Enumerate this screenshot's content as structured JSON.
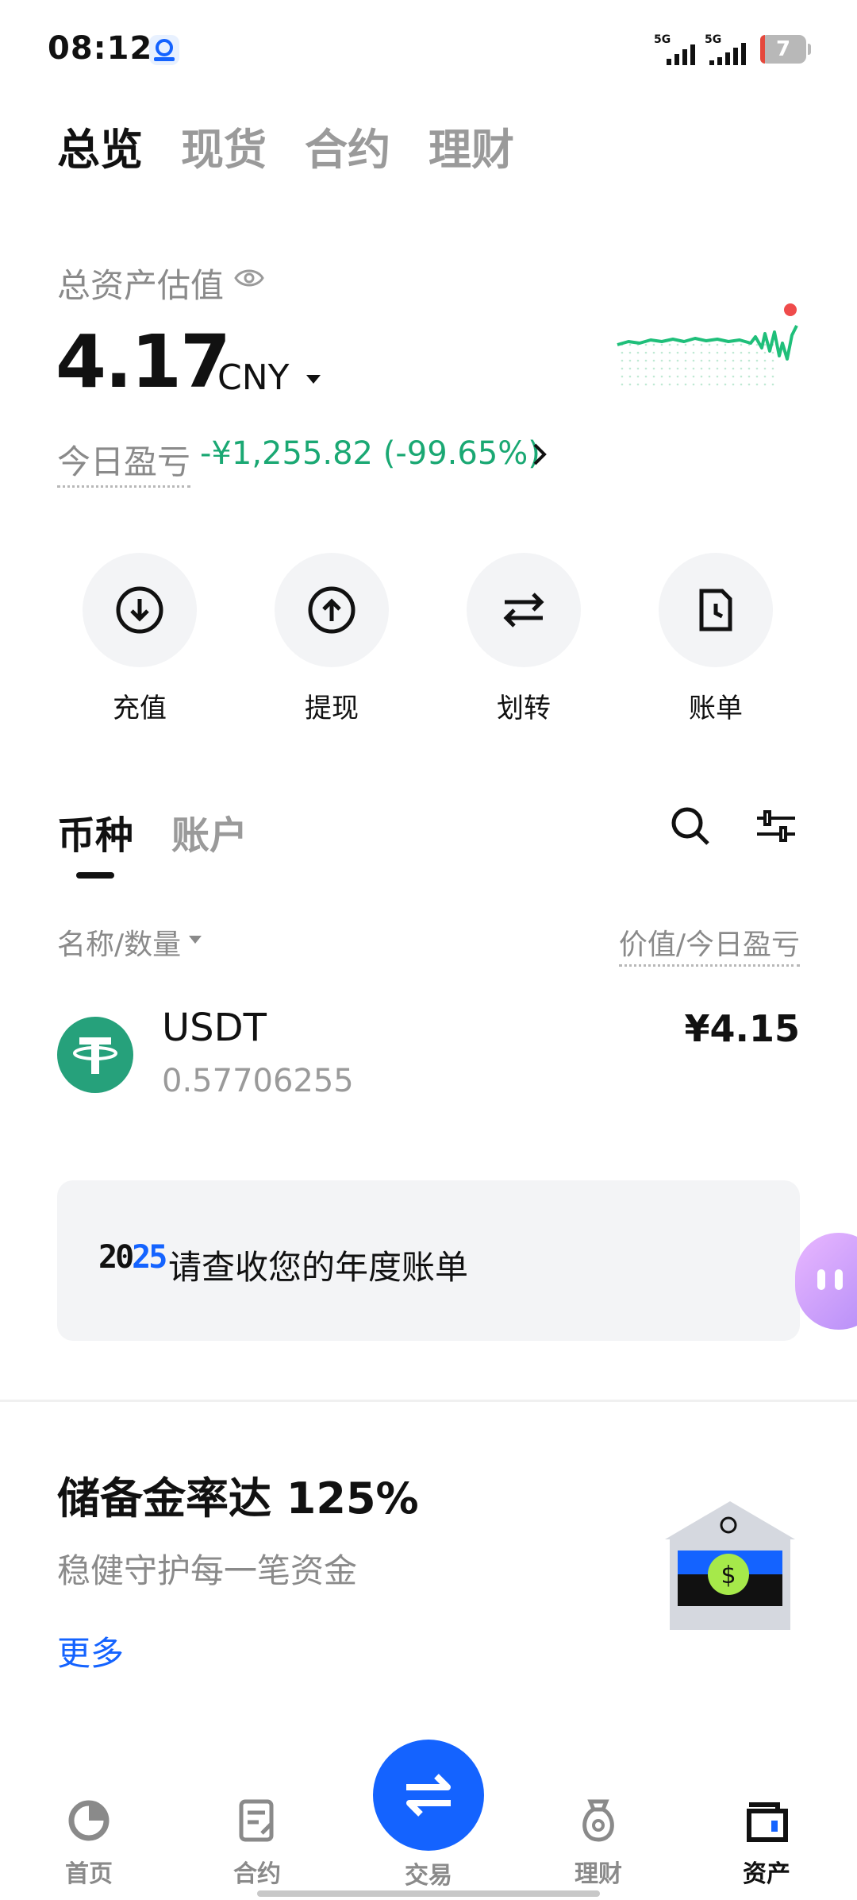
{
  "status_bar": {
    "time": "08:12",
    "signal1": "5G",
    "signal2": "5G",
    "battery": "7"
  },
  "top_tabs": [
    "总览",
    "现货",
    "合约",
    "理财"
  ],
  "summary": {
    "label": "总资产估值",
    "amount": "4.17",
    "currency": "CNY",
    "pnl_label": "今日盈亏",
    "pnl_value": "-¥1,255.82 (-99.65%)"
  },
  "actions": [
    {
      "label": "充值",
      "icon": "download-icon"
    },
    {
      "label": "提现",
      "icon": "upload-icon"
    },
    {
      "label": "划转",
      "icon": "transfer-icon"
    },
    {
      "label": "账单",
      "icon": "bill-icon"
    }
  ],
  "sub_tabs": [
    "币种",
    "账户"
  ],
  "columns": {
    "left": "名称/数量",
    "right": "价值/今日盈亏"
  },
  "assets": [
    {
      "name": "USDT",
      "quantity": "0.57706255",
      "value": "¥4.15"
    }
  ],
  "banner": {
    "year_prefix": "20",
    "year_suffix": "25",
    "text": "请查收您的年度账单"
  },
  "reserve": {
    "title": "储备金率达 125%",
    "subtitle": "稳健守护每一笔资金",
    "more": "更多"
  },
  "bottom_nav": [
    {
      "label": "首页",
      "icon": "home-icon"
    },
    {
      "label": "合约",
      "icon": "contract-icon"
    },
    {
      "label": "交易",
      "icon": "trade-icon"
    },
    {
      "label": "理财",
      "icon": "finance-icon"
    },
    {
      "label": "资产",
      "icon": "wallet-icon"
    }
  ],
  "colors": {
    "accent": "#1463ff",
    "positive": "#1aa873",
    "usdt": "#26a17b",
    "chart": "#1fbf7a"
  }
}
